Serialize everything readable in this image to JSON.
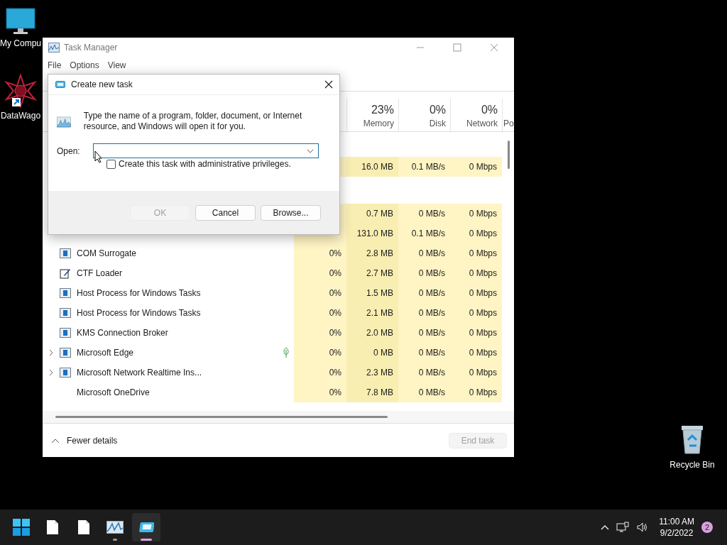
{
  "desktop_icons": [
    {
      "label": "My Compu",
      "kind": "computer"
    },
    {
      "label": "DataWago",
      "kind": "shortcut"
    },
    {
      "label": "Recycle Bin",
      "kind": "bin"
    }
  ],
  "task_manager": {
    "title": "Task Manager",
    "menu": [
      "File",
      "Options",
      "View"
    ],
    "columns": [
      {
        "value": "23%",
        "label": "Memory"
      },
      {
        "value": "0%",
        "label": "Disk"
      },
      {
        "value": "0%",
        "label": "Network"
      },
      {
        "label": "Po"
      }
    ],
    "groups": [
      {
        "rows": [
          {
            "memory": "16.0 MB",
            "disk": "0.1 MB/s",
            "network": "0 Mbps"
          }
        ]
      },
      {
        "rows": [
          {
            "memory": "0.7 MB",
            "disk": "0 MB/s",
            "network": "0 Mbps"
          },
          {
            "memory": "131.0 MB",
            "disk": "0.1 MB/s",
            "network": "0 Mbps"
          },
          {
            "name": "COM Surrogate",
            "kind": "service",
            "expandable": false,
            "cpu": "0%",
            "memory": "2.8 MB",
            "disk": "0 MB/s",
            "network": "0 Mbps"
          },
          {
            "name": "CTF Loader",
            "kind": "editor",
            "expandable": false,
            "cpu": "0%",
            "memory": "2.7 MB",
            "disk": "0 MB/s",
            "network": "0 Mbps"
          },
          {
            "name": "Host Process for Windows Tasks",
            "kind": "service",
            "expandable": false,
            "cpu": "0%",
            "memory": "1.5 MB",
            "disk": "0 MB/s",
            "network": "0 Mbps"
          },
          {
            "name": "Host Process for Windows Tasks",
            "kind": "service",
            "expandable": false,
            "cpu": "0%",
            "memory": "2.1 MB",
            "disk": "0 MB/s",
            "network": "0 Mbps"
          },
          {
            "name": "KMS Connection Broker",
            "kind": "service",
            "expandable": false,
            "cpu": "0%",
            "memory": "2.0 MB",
            "disk": "0 MB/s",
            "network": "0 Mbps"
          },
          {
            "name": "Microsoft Edge",
            "kind": "service",
            "expandable": true,
            "efficiency": true,
            "cpu": "0%",
            "memory": "0 MB",
            "disk": "0 MB/s",
            "network": "0 Mbps"
          },
          {
            "name": "Microsoft Network Realtime Ins...",
            "kind": "service",
            "expandable": true,
            "cpu": "0%",
            "memory": "2.3 MB",
            "disk": "0 MB/s",
            "network": "0 Mbps"
          },
          {
            "name": "Microsoft OneDrive",
            "kind": "none",
            "expandable": false,
            "cpu": "0%",
            "memory": "7.8 MB",
            "disk": "0 MB/s",
            "network": "0 Mbps"
          }
        ]
      }
    ],
    "fewer_details": "Fewer details",
    "end_task": {
      "label": "End task",
      "disabled": true
    }
  },
  "dialog": {
    "title": "Create new task",
    "message": "Type the name of a program, folder, document, or Internet resource, and Windows will open it for you.",
    "open_label": "Open:",
    "admin_checkbox": {
      "label": "Create this task with administrative privileges.",
      "checked": false
    },
    "buttons": [
      {
        "label": "OK",
        "disabled": true
      },
      {
        "label": "Cancel",
        "disabled": false
      },
      {
        "label": "Browse...",
        "disabled": false
      }
    ]
  },
  "taskbar": {
    "apps": [
      {
        "kind": "start",
        "running": false,
        "active": false
      },
      {
        "kind": "file",
        "running": false,
        "active": false
      },
      {
        "kind": "file",
        "running": false,
        "active": false
      },
      {
        "kind": "monitor",
        "running": true,
        "active": false
      },
      {
        "kind": "run",
        "running": true,
        "active": true
      }
    ],
    "time": "11:00 AM",
    "date": "9/2/2022",
    "notifications": "2"
  }
}
